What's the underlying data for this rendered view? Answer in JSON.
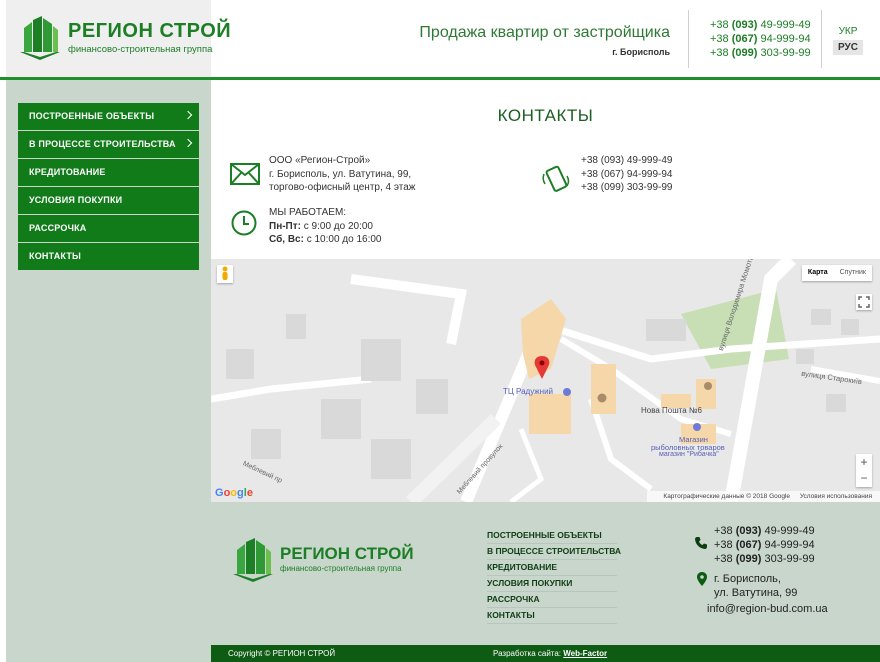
{
  "header": {
    "logo_title": "РЕГИОН СТРОЙ",
    "logo_subtitle": "финансово-строительная группа",
    "slogan": "Продажа квартир от застройщика",
    "city": "г. Борисполь",
    "phones": [
      {
        "prefix": "+38 ",
        "code": "(093)",
        "number": " 49-999-49"
      },
      {
        "prefix": "+38 ",
        "code": "(067)",
        "number": " 94-999-94"
      },
      {
        "prefix": "+38 ",
        "code": "(099)",
        "number": " 303-99-99"
      }
    ],
    "lang_ukr": "УКР",
    "lang_rus": "РУС"
  },
  "sidebar": {
    "items": [
      {
        "label": "ПОСТРОЕННЫЕ ОБЪЕКТЫ"
      },
      {
        "label": "В ПРОЦЕССЕ СТРОИТЕЛЬСТВА"
      },
      {
        "label": "КРЕДИТОВАНИЕ"
      },
      {
        "label": "УСЛОВИЯ ПОКУПКИ"
      },
      {
        "label": "РАССРОЧКА"
      },
      {
        "label": "КОНТАКТЫ"
      }
    ]
  },
  "contacts": {
    "title": "КОНТАКТЫ",
    "address_lines": [
      "ООО «Регион-Строй»",
      "г. Борисполь, ул. Ватутина, 99,",
      "торгово-офисный центр, 4 этаж"
    ],
    "hours_title": "МЫ РАБОТАЕМ:",
    "weekdays_label": "Пн-Пт:",
    "weekdays_time": " с 9:00 до 20:00",
    "weekend_label": "Сб, Вс:",
    "weekend_time": " с 10:00 до 16:00",
    "phones": [
      "+38 (093) 49-999-49",
      "+38 (067) 94-999-94",
      "+38 (099) 303-99-99"
    ]
  },
  "map": {
    "type_map": "Карта",
    "type_satellite": "Спутник",
    "zoom_in": "+",
    "zoom_out": "−",
    "google": "Google",
    "data_credit": "Картографические данные © 2018 Google",
    "terms": "Условия использования",
    "labels": {
      "mall": "ТЦ Радужний",
      "nova": "Нова Пошта №6",
      "shop1": "Магазин",
      "shop2": "рыболовных товаров",
      "shop3": "магазин \"Рибачка\"",
      "street_momota": "вулиця Володимира Момота",
      "street_starokyiv": "вулиця Старокиїв",
      "mebl1": "Меблевий пр",
      "mebl2": "Меблевий провулок"
    }
  },
  "footer": {
    "logo_title": "РЕГИОН СТРОЙ",
    "logo_subtitle": "финансово-строительная группа",
    "menu": [
      {
        "label": "ПОСТРОЕННЫЕ ОБЪЕКТЫ"
      },
      {
        "label": "В ПРОЦЕССЕ СТРОИТЕЛЬСТВА"
      },
      {
        "label": "КРЕДИТОВАНИЕ"
      },
      {
        "label": "УСЛОВИЯ ПОКУПКИ"
      },
      {
        "label": "РАССРОЧКА"
      },
      {
        "label": "КОНТАКТЫ"
      }
    ],
    "phones": [
      {
        "prefix": "+38 ",
        "code": "(093)",
        "number": " 49-999-49"
      },
      {
        "prefix": "+38 ",
        "code": "(067)",
        "number": " 94-999-94"
      },
      {
        "prefix": "+38 ",
        "code": "(099)",
        "number": " 303-99-99"
      }
    ],
    "address_lines": [
      "г. Борисполь,",
      "ул. Ватутина, 99"
    ],
    "email": "info@region-bud.com.ua",
    "copyright": "Copyright © РЕГИОН СТРОЙ",
    "dev_label": "Разработка сайта: ",
    "dev_link": "Web-Factor"
  },
  "colors": {
    "brand_green": "#107b18",
    "dark_green": "#0e5b14",
    "sidebar_bg": "#c9d6cc"
  }
}
